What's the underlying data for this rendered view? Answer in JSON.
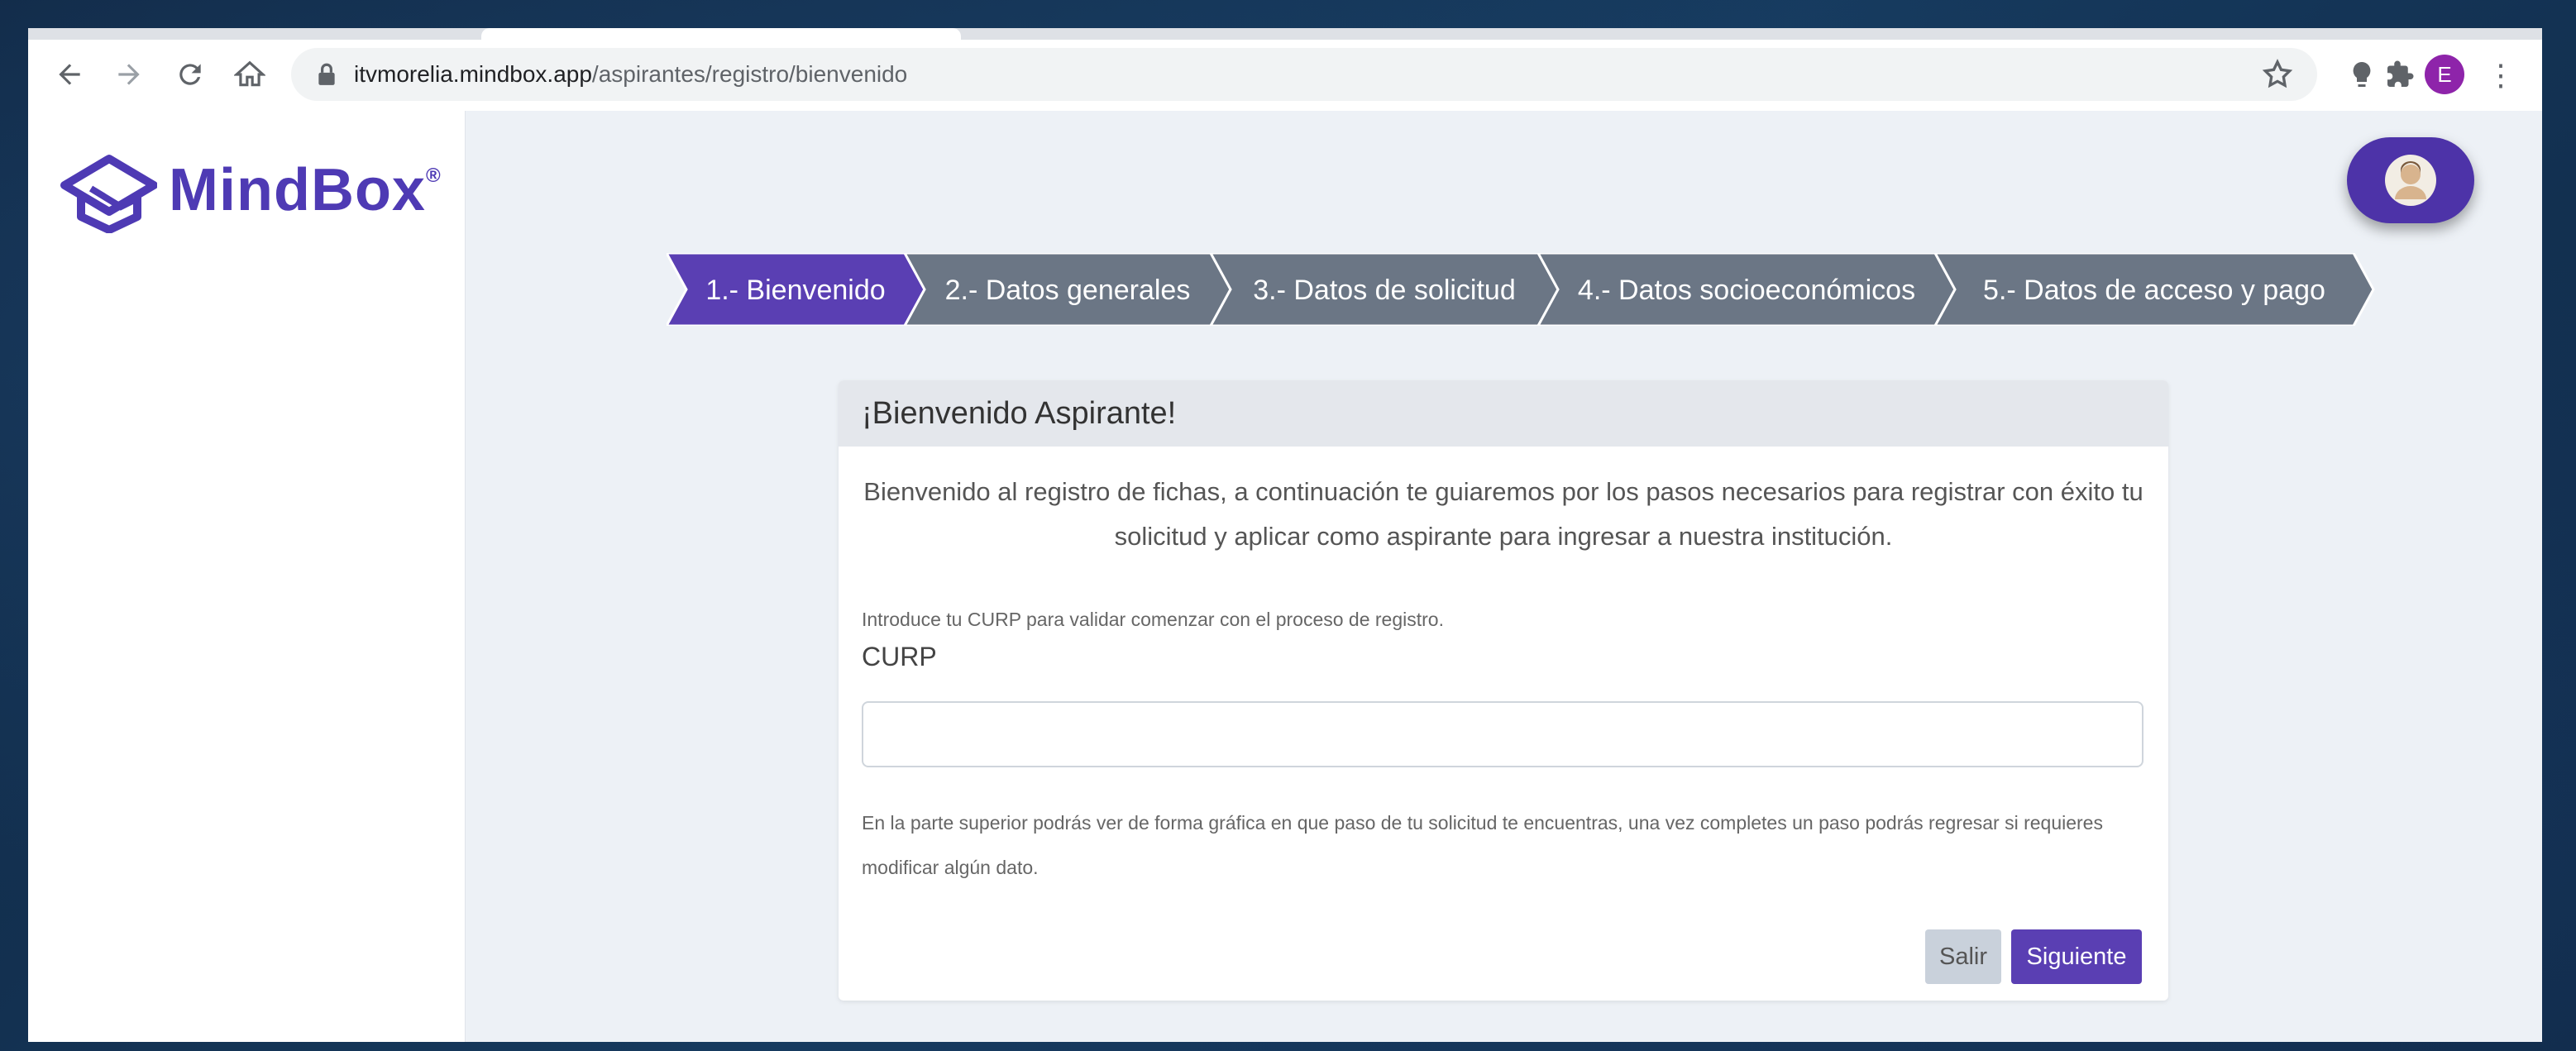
{
  "browser": {
    "url_host": "itvmorelia.mindbox.app",
    "url_path": "/aspirantes/registro/bienvenido",
    "profile_initial": "E"
  },
  "app": {
    "logo_text": "MindBox",
    "logo_mark": "®",
    "brand_color": "#5a3fb3"
  },
  "steps": [
    {
      "label": "1.- Bienvenido",
      "status": "active"
    },
    {
      "label": "2.- Datos generales",
      "status": "pending"
    },
    {
      "label": "3.- Datos de solicitud",
      "status": "pending"
    },
    {
      "label": "4.- Datos socioeconómicos",
      "status": "pending"
    },
    {
      "label": "5.- Datos de acceso y pago",
      "status": "pending"
    }
  ],
  "card": {
    "title": "¡Bienvenido Aspirante!",
    "intro": "Bienvenido al registro de fichas, a continuación te guiaremos por los pasos necesarios para registrar con éxito tu solicitud y aplicar como aspirante para ingresar a nuestra institución.",
    "hint": "Introduce tu CURP para validar comenzar con el proceso de registro.",
    "curp_label": "CURP",
    "curp_value": "",
    "note": "En la parte superior podrás ver de forma gráfica en que paso de tu solicitud te encuentras, una vez completes un paso podrás regresar si requieres modificar algún dato.",
    "exit_label": "Salir",
    "next_label": "Siguiente"
  },
  "icons": {
    "back": "arrow-left-icon",
    "forward": "arrow-right-icon",
    "reload": "reload-icon",
    "home": "home-icon",
    "lock": "lock-icon",
    "bookmark": "star-icon",
    "extension1": "lightbulb-icon",
    "extension2": "puzzle-icon",
    "menu": "more-vert-icon",
    "user": "user-avatar-icon"
  }
}
